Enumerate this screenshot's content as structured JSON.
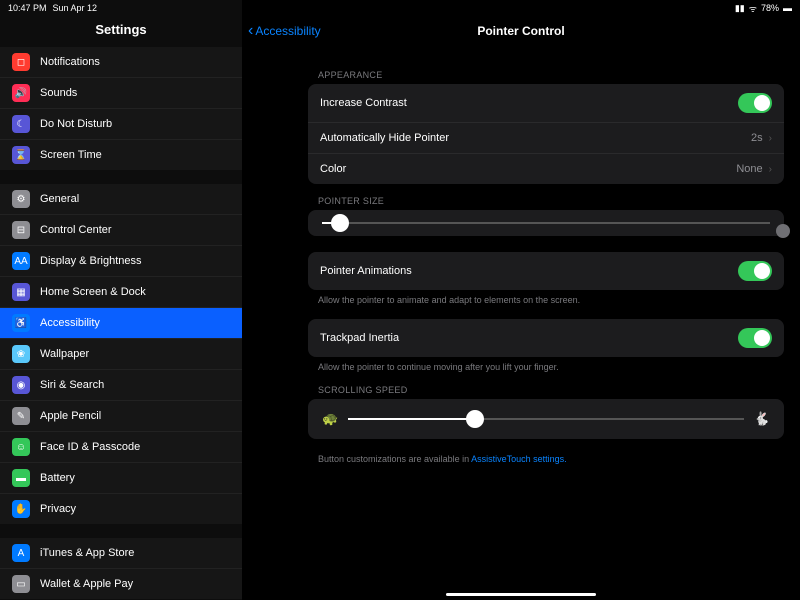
{
  "status": {
    "time": "10:47 PM",
    "date": "Sun Apr 12",
    "battery": "78%"
  },
  "sidebar": {
    "title": "Settings",
    "groups": [
      [
        {
          "label": "Notifications",
          "icon": "red",
          "glyph": "◻"
        },
        {
          "label": "Sounds",
          "icon": "pink",
          "glyph": "🔊"
        },
        {
          "label": "Do Not Disturb",
          "icon": "purple",
          "glyph": "☾"
        },
        {
          "label": "Screen Time",
          "icon": "indigo",
          "glyph": "⌛"
        }
      ],
      [
        {
          "label": "General",
          "icon": "gray",
          "glyph": "⚙"
        },
        {
          "label": "Control Center",
          "icon": "gray",
          "glyph": "⊟"
        },
        {
          "label": "Display & Brightness",
          "icon": "blue",
          "glyph": "AA"
        },
        {
          "label": "Home Screen & Dock",
          "icon": "indigo",
          "glyph": "▦"
        },
        {
          "label": "Accessibility",
          "icon": "blue",
          "glyph": "♿",
          "selected": true
        },
        {
          "label": "Wallpaper",
          "icon": "teal",
          "glyph": "❀"
        },
        {
          "label": "Siri & Search",
          "icon": "purple",
          "glyph": "◉"
        },
        {
          "label": "Apple Pencil",
          "icon": "gray",
          "glyph": "✎"
        },
        {
          "label": "Face ID & Passcode",
          "icon": "green",
          "glyph": "☺"
        },
        {
          "label": "Battery",
          "icon": "green",
          "glyph": "▬"
        },
        {
          "label": "Privacy",
          "icon": "blue",
          "glyph": "✋"
        }
      ],
      [
        {
          "label": "iTunes & App Store",
          "icon": "blue",
          "glyph": "A"
        },
        {
          "label": "Wallet & Apple Pay",
          "icon": "gray",
          "glyph": "▭"
        }
      ]
    ]
  },
  "nav": {
    "back": "Accessibility",
    "title": "Pointer Control"
  },
  "appearance": {
    "header": "APPEARANCE",
    "contrast": "Increase Contrast",
    "autohide": "Automatically Hide Pointer",
    "autohide_val": "2s",
    "color": "Color",
    "color_val": "None"
  },
  "pointer_size": {
    "header": "POINTER SIZE",
    "percent": 4
  },
  "animations": {
    "label": "Pointer Animations",
    "note": "Allow the pointer to animate and adapt to elements on the screen."
  },
  "inertia": {
    "label": "Trackpad Inertia",
    "note": "Allow the pointer to continue moving after you lift your finger."
  },
  "scroll": {
    "header": "SCROLLING SPEED",
    "percent": 32
  },
  "footer": {
    "text": "Button customizations are available in ",
    "link": "AssistiveTouch settings."
  }
}
